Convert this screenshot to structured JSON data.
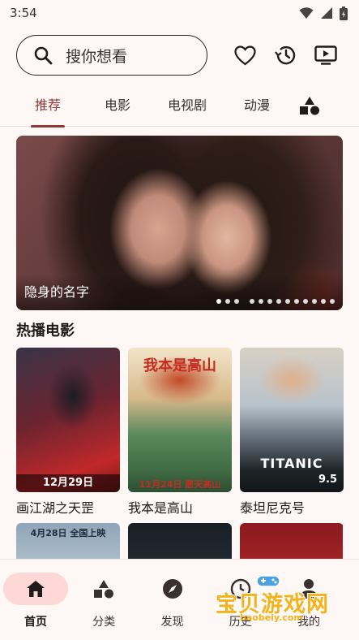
{
  "status_bar": {
    "time": "3:54"
  },
  "search": {
    "placeholder": "搜你想看"
  },
  "tabs": [
    {
      "label": "推荐",
      "active": true
    },
    {
      "label": "电影",
      "active": false
    },
    {
      "label": "电视剧",
      "active": false
    },
    {
      "label": "动漫",
      "active": false
    }
  ],
  "banner": {
    "title": "隐身的名字",
    "slide_count": 13,
    "active_index": 0
  },
  "hot_movies": {
    "heading": "热播电影",
    "items": [
      {
        "title": "画江湖之天罡",
        "poster_text": "12月29日"
      },
      {
        "title": "我本是高山",
        "poster_text": "11月24日 愿天高山",
        "poster_head": "我本是高山"
      },
      {
        "title": "泰坦尼克号",
        "poster_text": "TITANIC",
        "rating": "9.5"
      }
    ],
    "row2_items": [
      {
        "poster_text": "4月28日 全国上映"
      },
      {
        "poster_text": ""
      },
      {
        "poster_text": ""
      }
    ]
  },
  "bottom_nav": [
    {
      "label": "首页",
      "icon": "home-icon",
      "active": true
    },
    {
      "label": "分类",
      "icon": "category-icon",
      "active": false
    },
    {
      "label": "发现",
      "icon": "compass-icon",
      "active": false
    },
    {
      "label": "历史",
      "icon": "history-icon",
      "active": false
    },
    {
      "label": "我的",
      "icon": "person-icon",
      "active": false
    }
  ],
  "watermark": {
    "text": "宝贝游戏网",
    "url": "baobeiy.com"
  },
  "colors": {
    "accent": "#8c3a3c",
    "active_nav_bg": "#fdd8d6",
    "background": "#fdf7f5"
  }
}
